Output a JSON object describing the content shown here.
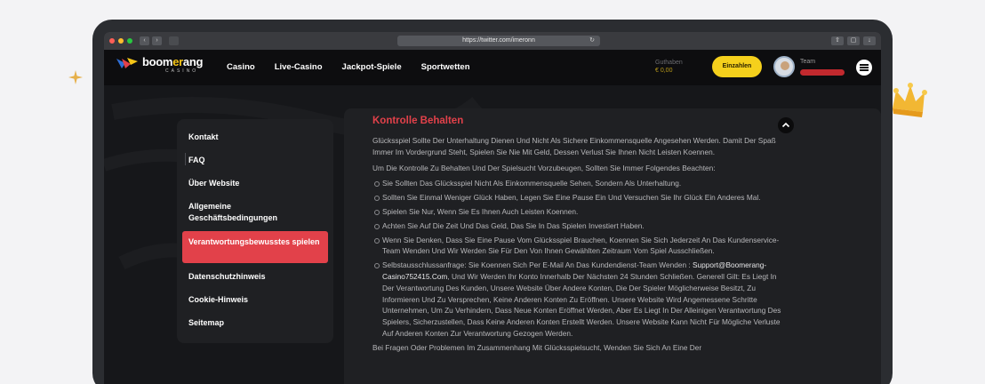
{
  "browser": {
    "url": "https://twitter.com/imeronn",
    "traffic_colors": [
      "#ff5f57",
      "#febc2e",
      "#28c840"
    ]
  },
  "header": {
    "logo": {
      "main_prefix": "boom",
      "main_accent": "er",
      "main_suffix": "ang",
      "sub": "CASINO"
    },
    "nav": [
      "Casino",
      "Live-Casino",
      "Jackpot-Spiele",
      "Sportwetten"
    ],
    "balance_label": "Guthaben",
    "balance_value": "€ 0,00",
    "deposit_label": "Einzahlen",
    "user_name": "Team"
  },
  "sidebar": {
    "items": [
      {
        "label": "Kontakt",
        "active": false
      },
      {
        "label": "FAQ",
        "active": false
      },
      {
        "label": "Über Website",
        "active": false
      },
      {
        "label": "Allgemeine Geschäftsbedingungen",
        "active": false
      },
      {
        "label": "Verantwortungsbewusstes spielen",
        "active": true
      },
      {
        "label": "Datenschutzhinweis",
        "active": false
      },
      {
        "label": "Cookie-Hinweis",
        "active": false
      },
      {
        "label": "Seitemap",
        "active": false
      }
    ]
  },
  "article": {
    "title": "Kontrolle Behalten",
    "intro": "Glücksspiel Sollte Der Unterhaltung Dienen Und Nicht Als Sichere Einkommensquelle Angesehen Werden. Damit Der Spaß Immer Im Vordergrund Steht, Spielen Sie Nie Mit Geld, Dessen Verlust Sie Ihnen Nicht Leisten Koennen.",
    "lead": "Um Die Kontrolle Zu Behalten Und Der Spielsucht Vorzubeugen, Sollten Sie Immer Folgendes Beachten:",
    "bullets": [
      "Sie Sollten Das Glücksspiel Nicht Als Einkommensquelle Sehen, Sondern Als Unterhaltung.",
      "Sollten Sie Einmal Weniger Glück Haben, Legen Sie Eine Pause Ein Und Versuchen Sie Ihr Glück Ein Anderes Mal.",
      "Spielen Sie Nur, Wenn Sie Es Ihnen Auch Leisten Koennen.",
      "Achten Sie Auf Die Zeit Und Das Geld, Das Sie In Das Spielen Investiert Haben.",
      "Wenn Sie Denken, Dass Sie Eine Pause Vom Glücksspiel Brauchen, Koennen Sie Sich Jederzeit An Das Kundenservice-Team Wenden Und Wir Werden Sie Für Den Von Ihnen Gewählten Zeitraum Vom Spiel Ausschließen."
    ],
    "selfexclusion_before": "Selbstausschlussanfrage: Sie Koennen Sich Per E-Mail An Das Kundendienst-Team Wenden :",
    "email": "Support@Boomerang-Casino752415.Com",
    "selfexclusion_after": ", Und Wir Werden Ihr Konto Innerhalb Der Nächsten 24 Stunden Schließen. Generell Gilt: Es Liegt In Der Verantwortung Des Kunden, Unsere Website Über Andere Konten, Die Der Spieler Möglicherweise Besitzt, Zu Informieren Und Zu Versprechen, Keine Anderen Konten Zu Eröffnen. Unsere Website Wird Angemessene Schritte Unternehmen, Um Zu Verhindern, Dass Neue Konten Eröffnet Werden, Aber Es Liegt In Der Alleinigen Verantwortung Des Spielers, Sicherzustellen, Dass Keine Anderen Konten Erstellt Werden. Unsere Website Kann Nicht Für Mögliche Verluste Auf Anderen Konten Zur Verantwortung Gezogen Werden.",
    "footer_text": "Bei Fragen Oder Problemen Im Zusammenhang Mit Glücksspielsucht, Wenden Sie Sich An Eine Der"
  },
  "colors": {
    "accent_red": "#e2414a",
    "accent_yellow": "#f5d01c",
    "panel_bg": "#1f2023",
    "page_bg": "#16171a"
  },
  "icons": [
    "sparkle-icon",
    "crown-icon",
    "chevron-up-icon",
    "menu-icon",
    "avatar"
  ]
}
